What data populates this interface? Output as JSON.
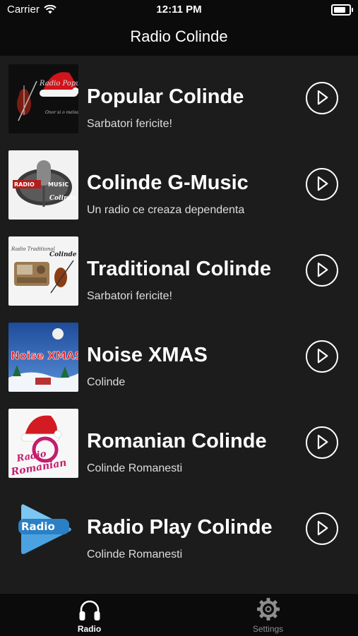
{
  "status_bar": {
    "carrier": "Carrier",
    "time": "12:11 PM",
    "battery_level": 1.0
  },
  "nav": {
    "title": "Radio Colinde"
  },
  "stations": [
    {
      "title": "Popular Colinde",
      "subtitle": "Sarbatori fericite!",
      "logo": "santa-hat-violin-logo",
      "logo_bg": "#0e0e0e"
    },
    {
      "title": "Colinde G-Music",
      "subtitle": "Un radio ce creaza dependenta",
      "logo": "retro-microphone-logo",
      "logo_bg": "#f2f2f2"
    },
    {
      "title": "Traditional Colinde",
      "subtitle": "Sarbatori fericite!",
      "logo": "radio-violin-logo",
      "logo_bg": "#f4f4f4"
    },
    {
      "title": "Noise XMAS",
      "subtitle": "Colinde",
      "logo": "winter-night-logo",
      "logo_bg": "#2c62b0"
    },
    {
      "title": "Romanian Colinde",
      "subtitle": "Colinde Romanesti",
      "logo": "santa-hat-radio-logo",
      "logo_bg": "#f7f7f7"
    },
    {
      "title": "Radio Play Colinde",
      "subtitle": "Colinde Romanesti",
      "logo": "play-button-logo",
      "logo_bg": "#1c1c1c"
    }
  ],
  "tabs": [
    {
      "label": "Radio",
      "icon": "headphones-icon",
      "active": true
    },
    {
      "label": "Settings",
      "icon": "gear-icon",
      "active": false
    }
  ],
  "colors": {
    "background": "#1c1c1c",
    "bar": "#0b0b0b",
    "active_tab": "#ffffff",
    "inactive_tab": "#8e8e8e"
  }
}
